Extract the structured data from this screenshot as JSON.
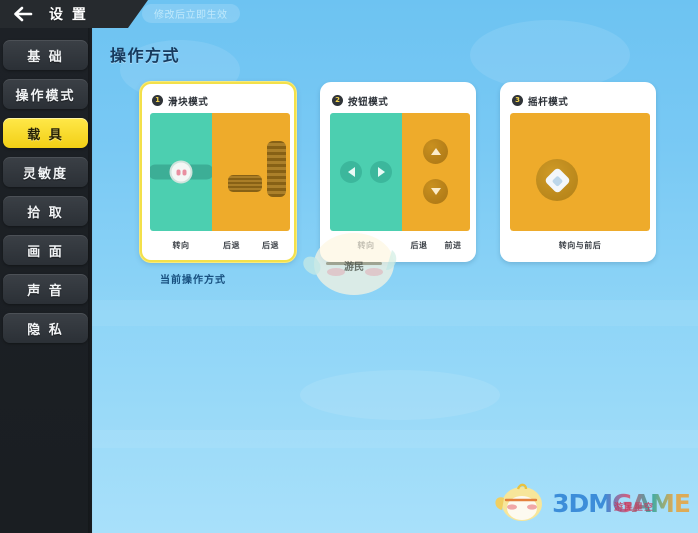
{
  "topbar": {
    "back_icon": "back-arrow-icon",
    "title": "设 置",
    "hint": "修改后立即生效"
  },
  "sidebar": {
    "items": [
      {
        "label": "基 础",
        "active": false
      },
      {
        "label": "操作模式",
        "active": false
      },
      {
        "label": "载 具",
        "active": true
      },
      {
        "label": "灵敏度",
        "active": false
      },
      {
        "label": "拾 取",
        "active": false
      },
      {
        "label": "画 面",
        "active": false
      },
      {
        "label": "声 音",
        "active": false
      },
      {
        "label": "隐 私",
        "active": false
      }
    ],
    "active_color": "#f2cf15"
  },
  "content": {
    "page_title": "操作方式",
    "current_mode_label": "当前操作方式",
    "cards": [
      {
        "badge": "1",
        "title": "滑块模式",
        "selected": true,
        "foot": [
          "转向",
          "后退",
          "后退"
        ]
      },
      {
        "badge": "2",
        "title": "按钮模式",
        "selected": false,
        "foot": [
          "转向",
          "后退",
          "前进"
        ]
      },
      {
        "badge": "3",
        "title": "摇杆模式",
        "selected": false,
        "foot": [
          "转向与前后"
        ]
      }
    ]
  },
  "watermark": {
    "text": "3DMGAME",
    "cn_text": "游民星空",
    "mascot": "chick-mascot-icon"
  },
  "colors": {
    "bg_top": "#6dc3f2",
    "bg_bottom": "#a8e0fa",
    "teal_pane": "#4ccfb0",
    "orange_pane": "#eeab2b",
    "sidebar_dark": "#1d2126",
    "highlight_yellow": "#f2cf15",
    "title_navy": "#173a5e"
  }
}
